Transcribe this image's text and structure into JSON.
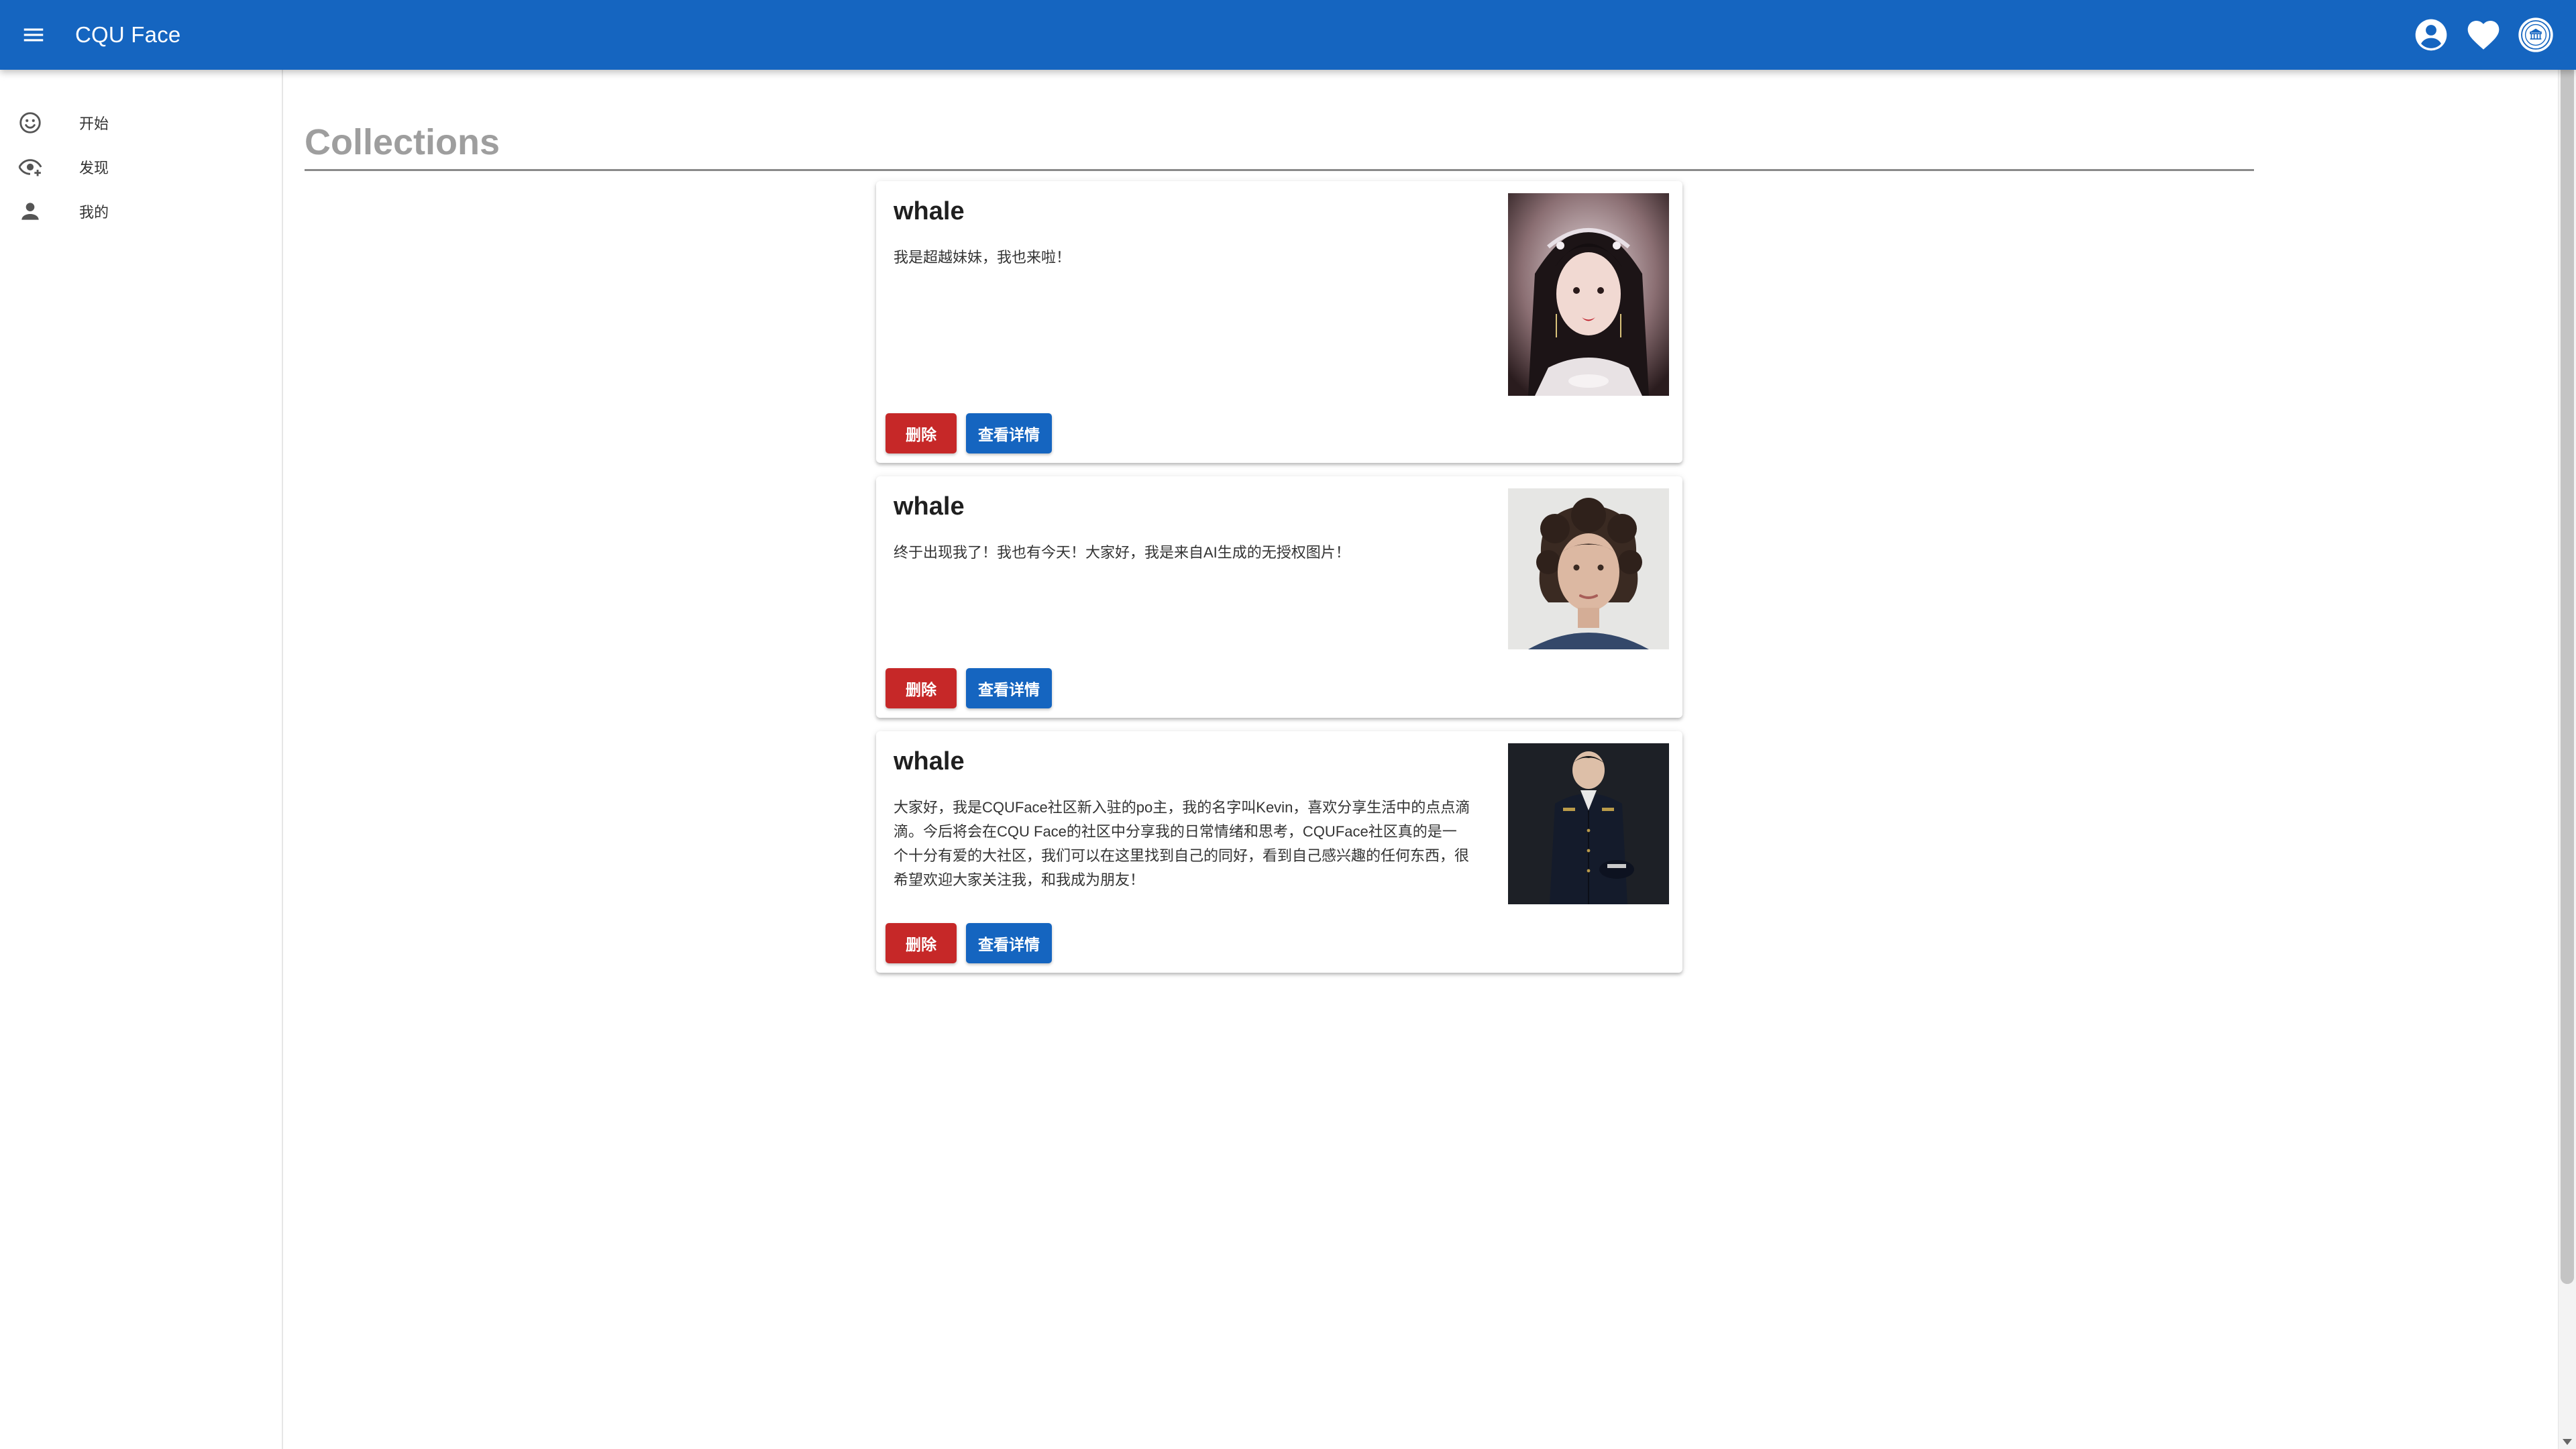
{
  "app": {
    "title": "CQU Face",
    "primary_color": "#1565c0",
    "danger_color": "#c62828"
  },
  "header": {
    "menu_icon": "menu-icon",
    "actions": [
      {
        "icon": "account-circle-icon"
      },
      {
        "icon": "heart-icon"
      },
      {
        "icon": "university-logo"
      }
    ]
  },
  "sidebar": {
    "items": [
      {
        "label": "开始",
        "icon": "smiley-icon"
      },
      {
        "label": "发现",
        "icon": "eye-plus-icon"
      },
      {
        "label": "我的",
        "icon": "person-icon"
      }
    ]
  },
  "main": {
    "page_title": "Collections",
    "cards": [
      {
        "title": "whale",
        "text": "我是超越妹妹，我也来啦！",
        "image": "portrait of woman with ornate hair accessories",
        "delete_label": "删除",
        "detail_label": "查看详情"
      },
      {
        "title": "whale",
        "text": "终于出现我了！我也有今天！大家好，我是来自AI生成的无授权图片！",
        "image": "portrait of woman with curly dark hair",
        "delete_label": "删除",
        "detail_label": "查看详情"
      },
      {
        "title": "whale",
        "text": "大家好，我是CQUFace社区新入驻的po主，我的名字叫Kevin，喜欢分享生活中的点点滴滴。今后将会在CQU Face的社区中分享我的日常情绪和思考，CQUFace社区真的是一个十分有爱的大社区，我们可以在这里找到自己的同好，看到自己感兴趣的任何东西，很希望欢迎大家关注我，和我成为朋友！",
        "image": "man in dark uniform holding cap",
        "delete_label": "删除",
        "detail_label": "查看详情"
      }
    ]
  }
}
